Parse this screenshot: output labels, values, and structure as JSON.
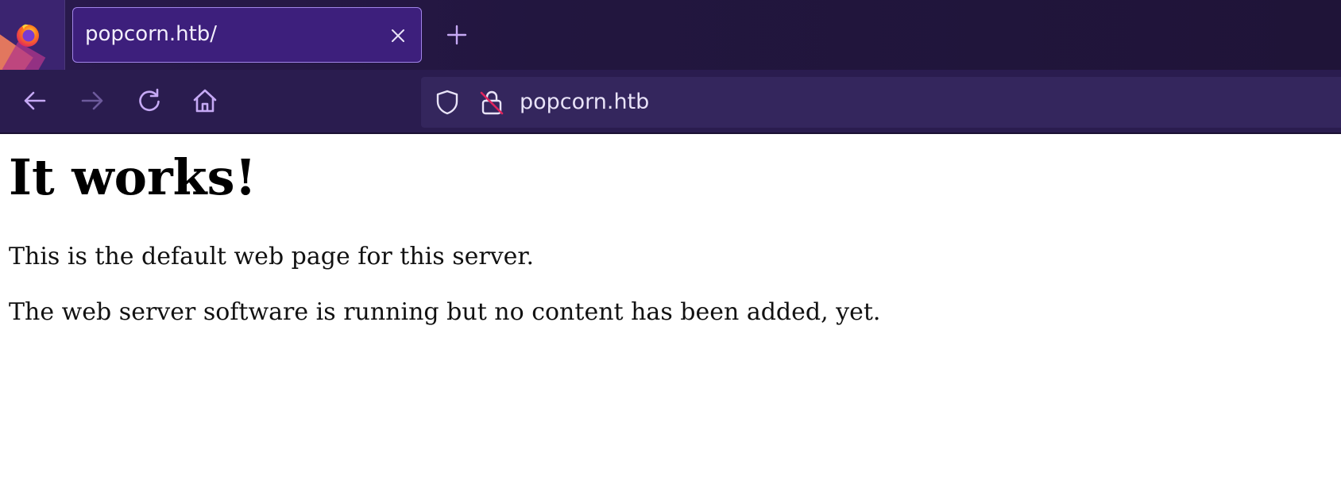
{
  "browser": {
    "tab": {
      "title": "popcorn.htb/"
    },
    "address_bar": {
      "url": "popcorn.htb"
    },
    "icons": {
      "app": "firefox-icon",
      "tab_close": "close-icon",
      "new_tab": "plus-icon",
      "back": "arrow-left-icon",
      "forward": "arrow-right-icon",
      "reload": "reload-icon",
      "home": "home-icon",
      "tracking_protection": "shield-icon",
      "connection": "insecure-lock-icon"
    },
    "colors": {
      "tabbar_bg": "#22163f",
      "toolbar_bg": "#2a1c4f",
      "active_tab_bg": "#3d1f7c",
      "active_tab_border": "#a184e8",
      "urlbar_bg": "#34265d",
      "icon_color": "#c6a9f5",
      "insecure_slash": "#e0245e"
    }
  },
  "page": {
    "heading": "It works!",
    "paragraph_1": "This is the default web page for this server.",
    "paragraph_2": "The web server software is running but no content has been added, yet."
  }
}
